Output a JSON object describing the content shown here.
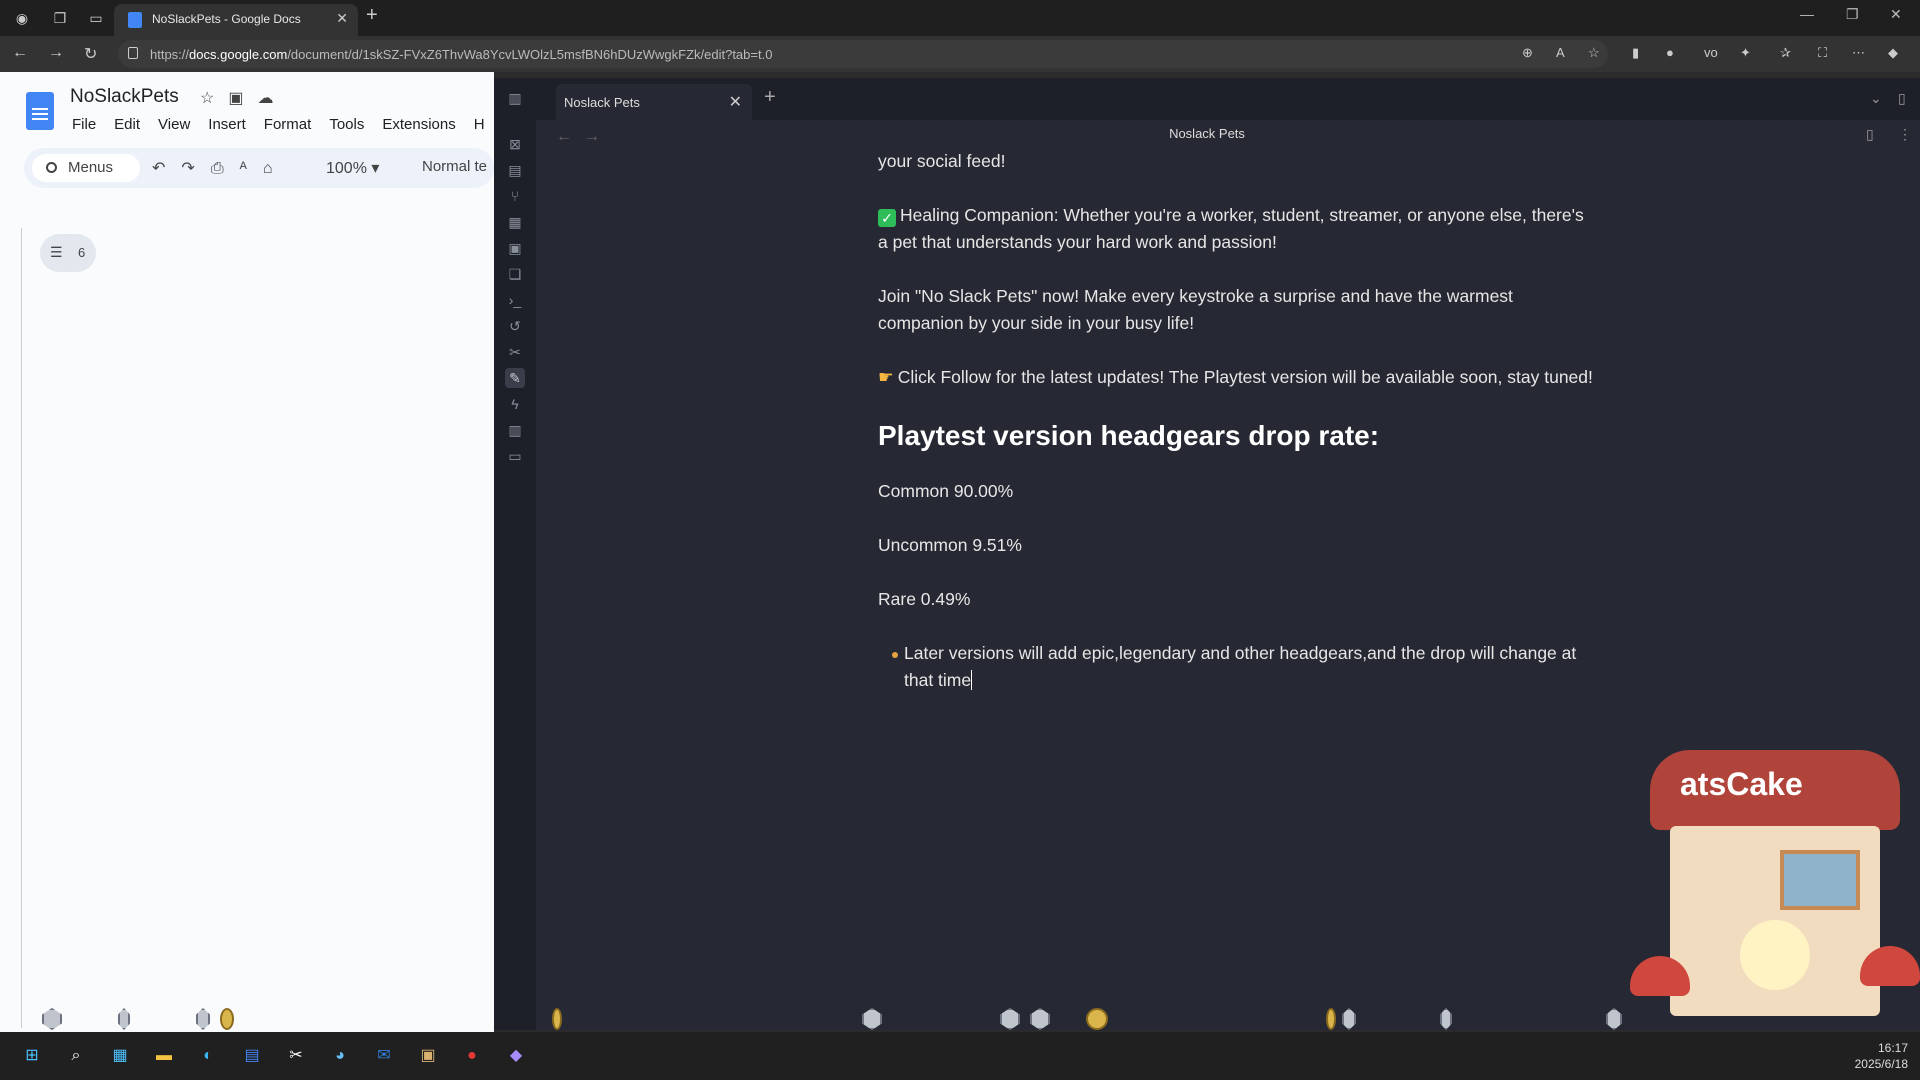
{
  "browser": {
    "tab_title": "NoSlackPets - Google Docs",
    "url_prefix": "https://",
    "url_domain": "docs.google.com",
    "url_path": "/document/d/1skSZ-FVxZ6ThvWa8YcvLWOlzL5msfBN6hDUzWwgkFZk/edit?tab=t.0"
  },
  "docs": {
    "title": "NoSlackPets",
    "menu": [
      "File",
      "Edit",
      "View",
      "Insert",
      "Format",
      "Tools",
      "Extensions",
      "H"
    ],
    "search_label": "Menus",
    "zoom": "100%",
    "style": "Normal te",
    "outline_count": "6"
  },
  "app": {
    "tab_label": "Noslack Pets",
    "page_title": "Noslack Pets",
    "content": {
      "line0": "your social feed!",
      "healing": "Healing Companion: Whether you're a worker, student, streamer, or anyone else, there's a pet that understands your hard work and passion!",
      "join": "Join \"No Slack Pets\" now! Make every keystroke a surprise and have the warmest companion by your side in your busy life!",
      "follow": "Click Follow for the latest updates! The Playtest version will be available soon, stay tuned!",
      "heading": "Playtest version headgears drop rate:",
      "common": "Common 90.00%",
      "uncommon": "Uncommon 9.51%",
      "rare": "Rare 0.49%",
      "bullet": "Later versions will add epic,legendary and other headgears,and the drop will change at that time"
    }
  },
  "cafe_sign": "atsCake",
  "taskbar": {
    "time": "16:17",
    "date": "2025/6/18"
  }
}
